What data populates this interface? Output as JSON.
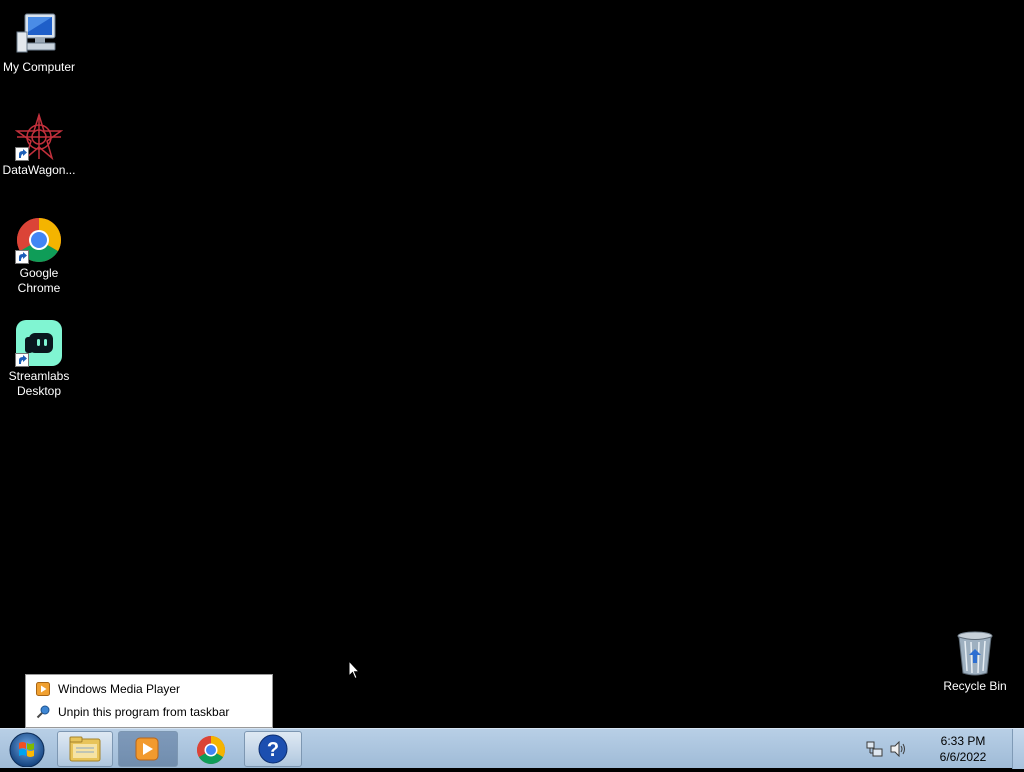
{
  "desktop": {
    "icons": [
      {
        "label": "My Computer",
        "icon": "computer-icon"
      },
      {
        "label": "DataWagon...",
        "icon": "datawagon-icon"
      },
      {
        "label": "Google Chrome",
        "icon": "chrome-icon"
      },
      {
        "label": "Streamlabs Desktop",
        "icon": "streamlabs-icon"
      },
      {
        "label": "Recycle Bin",
        "icon": "recycle-bin-icon"
      }
    ]
  },
  "jump_menu": {
    "items": [
      {
        "label": "Windows Media Player",
        "icon": "media-player-icon"
      },
      {
        "label": "Unpin this program from taskbar",
        "icon": "unpin-icon"
      }
    ]
  },
  "taskbar": {
    "buttons": [
      {
        "name": "start",
        "icon": "windows-orb-icon"
      },
      {
        "name": "explorer",
        "icon": "folder-icon"
      },
      {
        "name": "media-player",
        "icon": "media-player-icon"
      },
      {
        "name": "chrome",
        "icon": "chrome-icon"
      },
      {
        "name": "help",
        "icon": "help-icon"
      }
    ],
    "tray": {
      "time": "6:33 PM",
      "date": "6/6/2022"
    }
  }
}
